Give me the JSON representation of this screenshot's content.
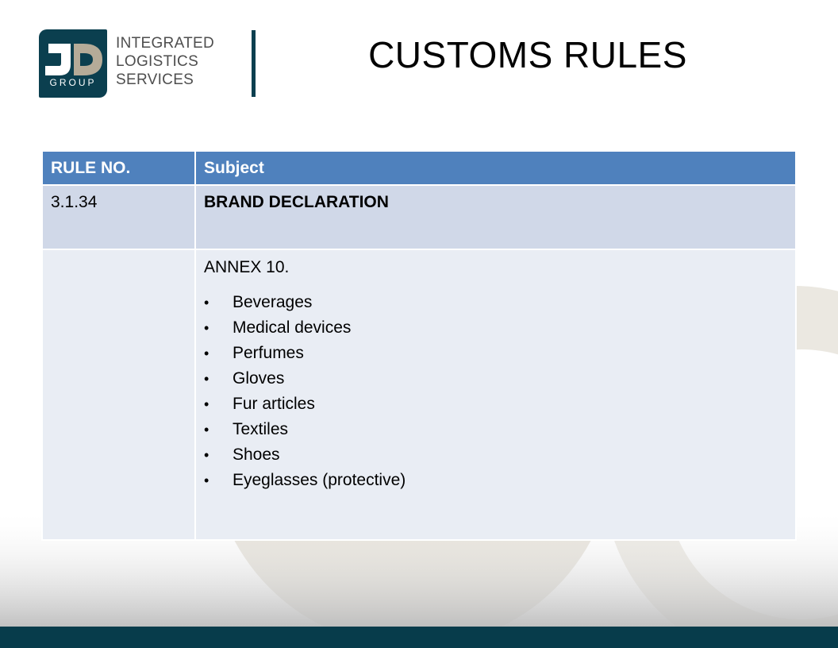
{
  "header": {
    "logo": {
      "mark_letters": "JD",
      "group_word": "GROUP",
      "text_lines": [
        "INTEGRATED",
        "LOGISTICS",
        "SERVICES"
      ]
    },
    "title": "CUSTOMS RULES"
  },
  "table": {
    "headers": [
      "RULE NO.",
      "Subject"
    ],
    "rows": [
      {
        "rule_no": "3.1.34",
        "subject": "BRAND DECLARATION"
      },
      {
        "rule_no": "",
        "annex": "ANNEX 10.",
        "items": [
          "Beverages",
          "Medical devices",
          "Perfumes",
          "Gloves",
          "Fur articles",
          "Textiles",
          "Shoes",
          "Eyeglasses (protective)"
        ]
      }
    ]
  },
  "icons": {
    "bullet": "•"
  },
  "colors": {
    "brand_dark": "#0b3f4f",
    "header_blue": "#4f81bd",
    "row_dark": "#d0d8e8",
    "row_light": "#e9edf4",
    "footer": "#073c4b"
  }
}
